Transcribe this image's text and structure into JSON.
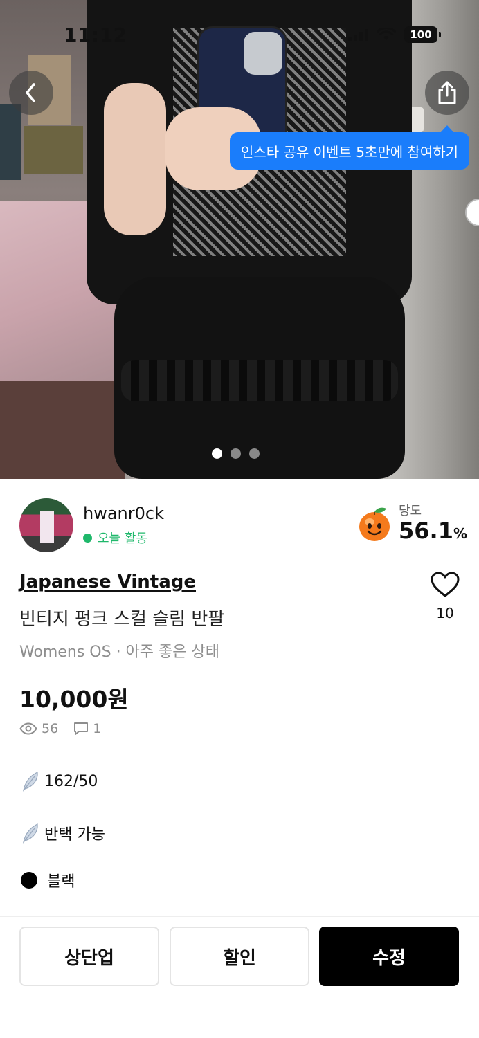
{
  "status_bar": {
    "time": "11:12",
    "battery": "100"
  },
  "overlay": {
    "share_tooltip": "인스타 공유 이벤트 5초만에 참여하기"
  },
  "gallery": {
    "page_count": 3,
    "active_index": 0
  },
  "seller": {
    "name": "hwanr0ck",
    "activity": "오늘 활동",
    "temperature_label": "당도",
    "temperature_value": "56.1",
    "temperature_unit": "%"
  },
  "product": {
    "brand": "Japanese Vintage",
    "title": "빈티지 펑크 스컬 슬림 반팔",
    "meta": "Womens OS · 아주 좋은 상태",
    "price": "10,000원",
    "views": "56",
    "comments": "1",
    "likes": "10"
  },
  "description": {
    "line1": "162/50",
    "line2": "반택 가능",
    "line3": "블랙"
  },
  "actions": {
    "bump": "상단업",
    "discount": "할인",
    "edit": "수정"
  }
}
